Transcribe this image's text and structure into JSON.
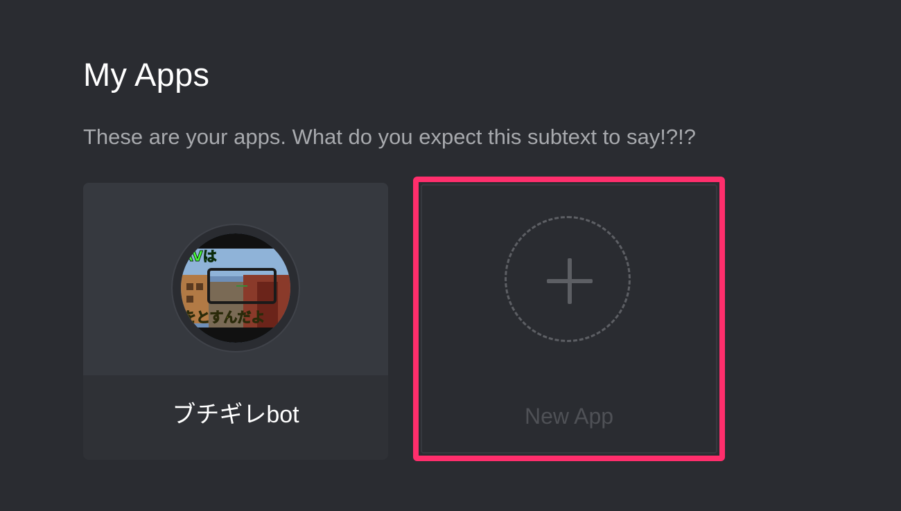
{
  "page": {
    "title": "My Apps",
    "subtitle": "These are your apps. What do you expect this subtext to say!?!?"
  },
  "apps": [
    {
      "name": "ブチギレbot",
      "avatar_text_top": "AVは",
      "avatar_text_bottom": "をとすんだよ"
    }
  ],
  "new_app": {
    "label": "New App",
    "icon": "plus-icon"
  },
  "colors": {
    "background": "#2a2c31",
    "card": "#2f3136",
    "card_header": "#36393f",
    "highlight": "#ff2e6c",
    "subtext": "#a8aaae",
    "muted": "#4f5156"
  }
}
